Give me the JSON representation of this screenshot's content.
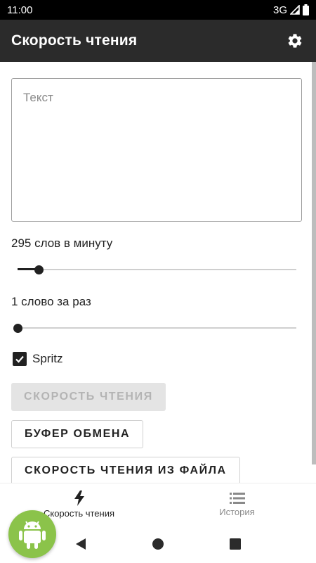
{
  "status_bar": {
    "time": "11:00",
    "network": "3G"
  },
  "app_bar": {
    "title": "Скорость чтения"
  },
  "text_input": {
    "placeholder": "Текст",
    "value": ""
  },
  "speed": {
    "label": "295 слов в минуту",
    "slider_fraction": 0.075
  },
  "words": {
    "label": "1 слово за раз",
    "slider_fraction": 0.0
  },
  "spritz": {
    "label": "Spritz",
    "checked": true
  },
  "buttons": {
    "speed_reading": "Скорость чтения",
    "clipboard": "Буфер обмена",
    "from_file": "Скорость чтения из файла"
  },
  "bottom_nav": {
    "items": [
      {
        "label": "Скорость чтения",
        "icon": "lightning-icon",
        "active": true
      },
      {
        "label": "История",
        "icon": "list-icon",
        "active": false
      }
    ]
  },
  "colors": {
    "app_bar": "#2b2b2b",
    "accent": "#212121",
    "fab": "#8bc34a"
  }
}
